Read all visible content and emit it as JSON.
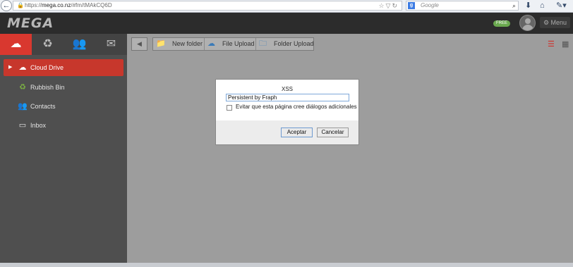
{
  "browser": {
    "url_prefix": "https://",
    "url_domain": "mega.co.nz",
    "url_path": "/#fm/tMAkCQ6D",
    "search_placeholder": "Google"
  },
  "header": {
    "logo": "MEGA",
    "badge": "FREE",
    "menu_label": "Menu"
  },
  "sidebar": {
    "items": [
      {
        "label": "Cloud Drive",
        "icon": "cloud-icon"
      },
      {
        "label": "Rubbish Bin",
        "icon": "recycle-icon"
      },
      {
        "label": "Contacts",
        "icon": "contacts-icon"
      },
      {
        "label": "Inbox",
        "icon": "inbox-icon"
      }
    ]
  },
  "toolbar": {
    "new_folder": "New folder",
    "file_upload": "File Upload",
    "folder_upload": "Folder Upload"
  },
  "dialog": {
    "title": "XSS",
    "input_value": "Persistent by Fraph",
    "checkbox_label": "Evitar que esta página cree diálogos adicionales",
    "ok_label": "Aceptar",
    "cancel_label": "Cancelar"
  },
  "colors": {
    "accent": "#d9382f",
    "badge": "#6aa84f"
  }
}
